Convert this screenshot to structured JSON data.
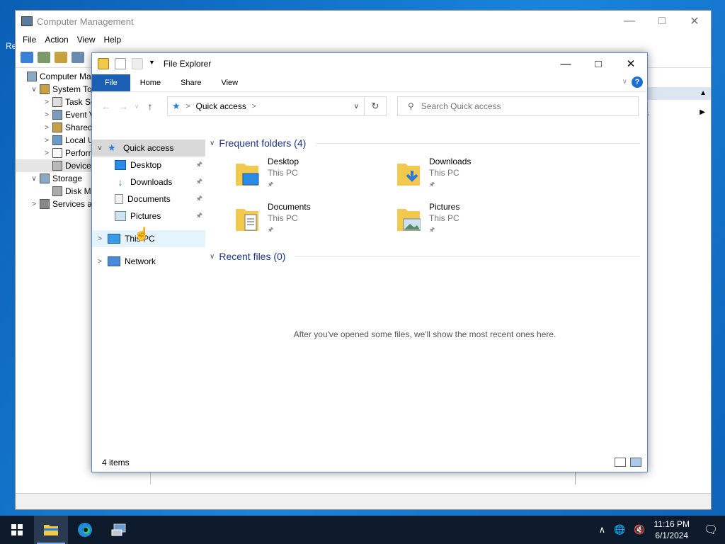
{
  "desktop": {
    "icon_label": "Re"
  },
  "computer_management": {
    "title": "Computer Management",
    "menu": [
      "File",
      "Action",
      "View",
      "Help"
    ],
    "tree": [
      {
        "label": "Computer Man",
        "indent": 0,
        "chevron": ""
      },
      {
        "label": "System Tool",
        "indent": 1,
        "chevron": "v"
      },
      {
        "label": "Task Sch",
        "indent": 2,
        "chevron": ">"
      },
      {
        "label": "Event Vi",
        "indent": 2,
        "chevron": ">"
      },
      {
        "label": "Shared F",
        "indent": 2,
        "chevron": ">"
      },
      {
        "label": "Local Us",
        "indent": 2,
        "chevron": ">"
      },
      {
        "label": "Perform",
        "indent": 2,
        "chevron": ">"
      },
      {
        "label": "Device M",
        "indent": 2,
        "chevron": ""
      },
      {
        "label": "Storage",
        "indent": 1,
        "chevron": "v"
      },
      {
        "label": "Disk Mar",
        "indent": 2,
        "chevron": ""
      },
      {
        "label": "Services and",
        "indent": 1,
        "chevron": ">"
      }
    ],
    "actions_suffix": "s"
  },
  "file_explorer": {
    "title": "File Explorer",
    "ribbon_tabs": [
      "File",
      "Home",
      "Share",
      "View"
    ],
    "address_path": "Quick access",
    "search_placeholder": "Search Quick access",
    "nav": {
      "quick_access": "Quick access",
      "pinned": [
        "Desktop",
        "Downloads",
        "Documents",
        "Pictures"
      ],
      "this_pc": "This PC",
      "network": "Network"
    },
    "frequent_header": "Frequent folders (4)",
    "recent_header": "Recent files (0)",
    "folders": [
      {
        "name": "Desktop",
        "location": "This PC"
      },
      {
        "name": "Downloads",
        "location": "This PC"
      },
      {
        "name": "Documents",
        "location": "This PC"
      },
      {
        "name": "Pictures",
        "location": "This PC"
      }
    ],
    "empty_message": "After you've opened some files, we'll show the most recent ones here.",
    "status_count": "4 items"
  },
  "taskbar": {
    "time": "11:16 PM",
    "date": "6/1/2024"
  },
  "colors": {
    "accent": "#1a5fb4",
    "taskbar": "#0d1a2b",
    "folder": "#f2c94c",
    "group_header": "#1e3287"
  }
}
